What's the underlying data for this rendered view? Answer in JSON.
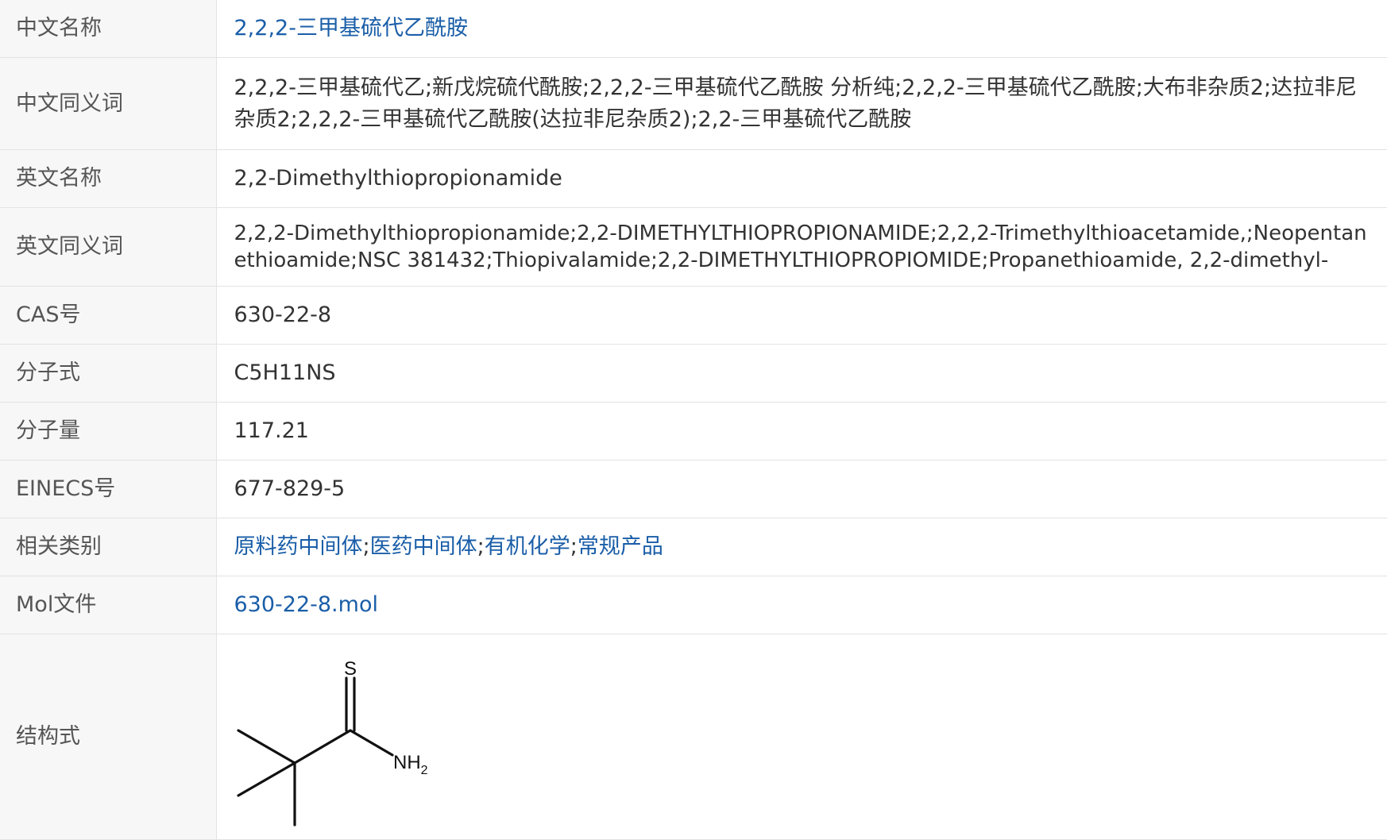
{
  "rows": [
    {
      "label": "中文名称",
      "value": "2,2,2-三甲基硫代乙酰胺"
    },
    {
      "label": "中文同义词",
      "value": "2,2,2-三甲基硫代乙;新戊烷硫代酰胺;2,2,2-三甲基硫代乙酰胺 分析纯;2,2,2-三甲基硫代乙酰胺;大布非杂质2;达拉非尼杂质2;2,2,2-三甲基硫代乙酰胺(达拉非尼杂质2);2,2-三甲基硫代乙酰胺"
    },
    {
      "label": "英文名称",
      "value": "2,2-Dimethylthiopropionamide"
    },
    {
      "label": "英文同义词",
      "value": "2,2,2-Dimethylthiopropionamide;2,2-DIMETHYLTHIOPROPIONAMIDE;2,2,2-Trimethylthioacetamide,;Neopentanethioamide;NSC 381432;Thiopivalamide;2,2-DIMETHYLTHIOPROPIOMIDE;Propanethioamide, 2,2-dimethyl-"
    },
    {
      "label": "CAS号",
      "value": "630-22-8"
    },
    {
      "label": "分子式",
      "value": "C5H11NS"
    },
    {
      "label": "分子量",
      "value": "117.21"
    },
    {
      "label": "EINECS号",
      "value": "677-829-5"
    },
    {
      "label": "相关类别",
      "links": [
        "原料药中间体",
        "医药中间体",
        "有机化学",
        "常规产品"
      ],
      "separator": ";"
    },
    {
      "label": "Mol文件",
      "value": "630-22-8.mol"
    },
    {
      "label": "结构式",
      "atoms": {
        "sulfur": "S",
        "amine": "NH",
        "amine_subscript": "2"
      }
    }
  ],
  "colors": {
    "link": "#1a5ea8",
    "label_bg": "#f7f7f7",
    "border": "#e3e3e3",
    "text": "#333333"
  }
}
